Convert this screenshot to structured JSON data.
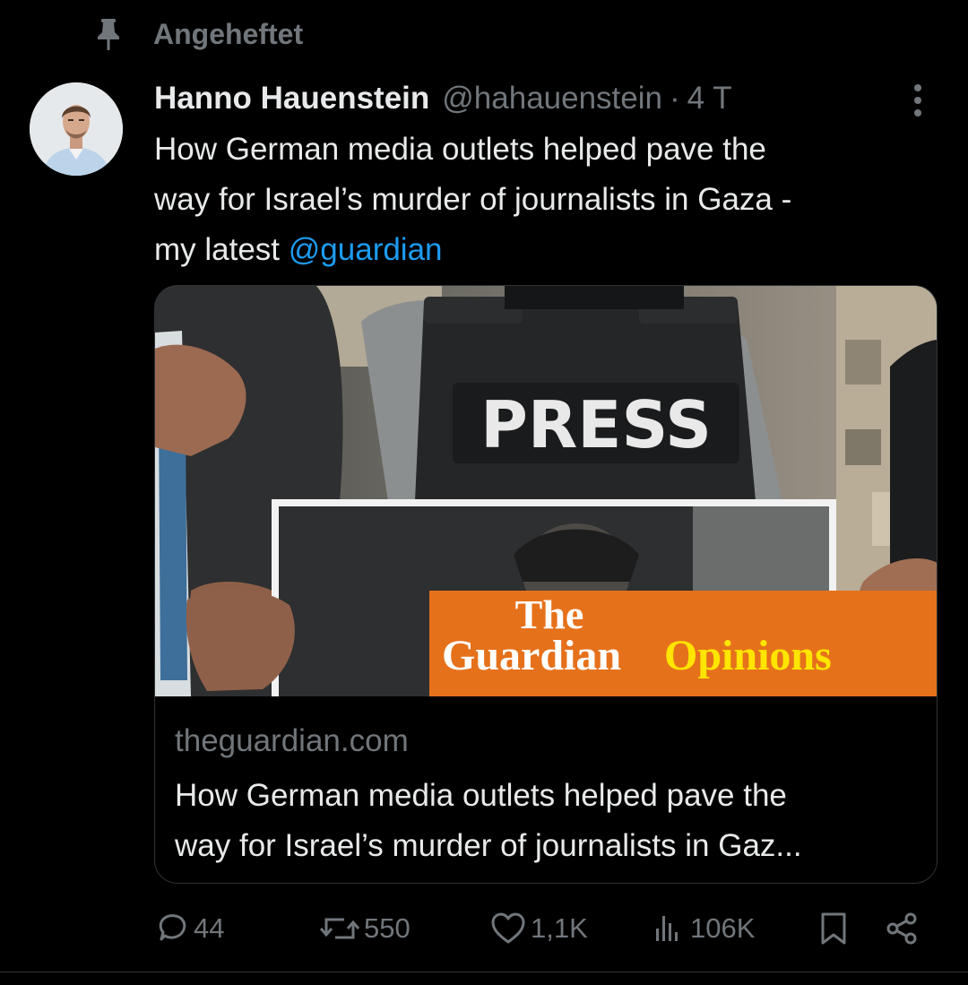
{
  "pinned": {
    "label": "Angeheftet"
  },
  "tweet": {
    "author_name": "Hanno Hauenstein",
    "author_handle": "@hahauenstein",
    "separator": "·",
    "time": "4 T",
    "text_lines": [
      "How German media outlets helped pave the",
      "way for Israel’s murder of journalists in Gaza -",
      "my latest "
    ],
    "mention": "@guardian"
  },
  "card": {
    "image_press_text": "PRESS",
    "image_brand_line1": "The",
    "image_brand_line2": "Guardian",
    "image_brand_section": "Opinions",
    "domain": "theguardian.com",
    "title_lines": [
      "How German media outlets helped pave the",
      "way for Israel’s murder of journalists in Gaz..."
    ]
  },
  "actions": {
    "replies": "44",
    "reposts": "550",
    "likes": "1,1K",
    "views": "106K"
  },
  "colors": {
    "background": "#000000",
    "text": "#e7e9ea",
    "muted": "#71767b",
    "link": "#1d9bf0",
    "border": "#2f3336",
    "guardian_orange": "#e6711b",
    "guardian_yellow": "#ffe500"
  },
  "icons": [
    "pin-icon",
    "more-icon",
    "reply-icon",
    "repost-icon",
    "like-icon",
    "views-icon",
    "bookmark-icon",
    "share-icon"
  ]
}
